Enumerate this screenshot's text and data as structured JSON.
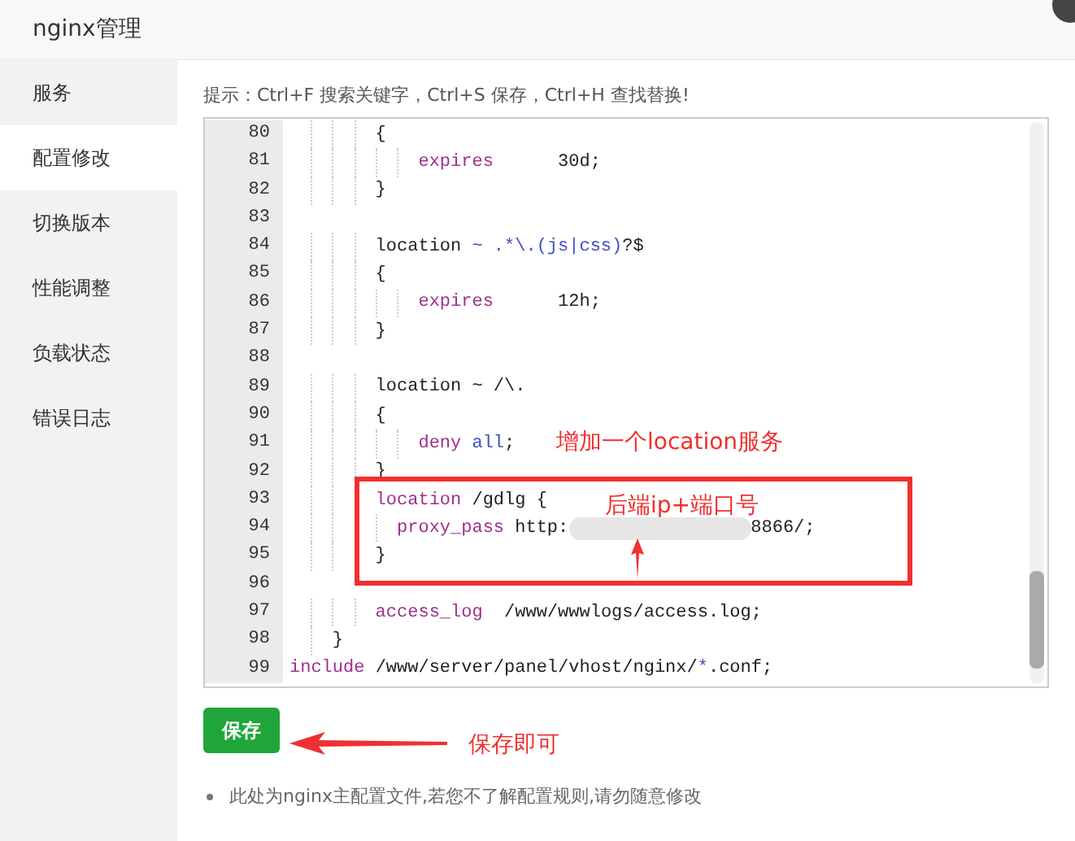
{
  "window": {
    "title": "nginx管理"
  },
  "sidebar": {
    "items": [
      {
        "label": "服务",
        "selected": false
      },
      {
        "label": "配置修改",
        "selected": true
      },
      {
        "label": "切换版本",
        "selected": false
      },
      {
        "label": "性能调整",
        "selected": false
      },
      {
        "label": "负载状态",
        "selected": false
      },
      {
        "label": "错误日志",
        "selected": false
      }
    ]
  },
  "hint": "提示：Ctrl+F 搜索关键字，Ctrl+S 保存，Ctrl+H 查找替换!",
  "editor": {
    "lines": [
      {
        "number": "80",
        "tokens": [
          {
            "text": "        {",
            "kind": "plain"
          }
        ]
      },
      {
        "number": "81",
        "tokens": [
          {
            "text": "            expires",
            "kind": "keyword"
          },
          {
            "text": "      30d;",
            "kind": "plain"
          }
        ]
      },
      {
        "number": "82",
        "tokens": [
          {
            "text": "        }",
            "kind": "plain"
          }
        ]
      },
      {
        "number": "83"
      },
      {
        "number": "84",
        "tokens": [
          {
            "text": "        location ",
            "kind": "plain"
          },
          {
            "text": "~ .*\\.(js|css)",
            "kind": "operator"
          },
          {
            "text": "?$",
            "kind": "plain"
          }
        ]
      },
      {
        "number": "85",
        "tokens": [
          {
            "text": "        {",
            "kind": "plain"
          }
        ]
      },
      {
        "number": "86",
        "tokens": [
          {
            "text": "            expires",
            "kind": "keyword"
          },
          {
            "text": "      12h;",
            "kind": "plain"
          }
        ]
      },
      {
        "number": "87",
        "tokens": [
          {
            "text": "        }",
            "kind": "plain"
          }
        ]
      },
      {
        "number": "88"
      },
      {
        "number": "89",
        "tokens": [
          {
            "text": "        location ~ /\\.",
            "kind": "plain"
          }
        ]
      },
      {
        "number": "90",
        "tokens": [
          {
            "text": "        {",
            "kind": "plain"
          }
        ]
      },
      {
        "number": "91",
        "tokens": [
          {
            "text": "            deny",
            "kind": "keyword"
          },
          {
            "text": " all",
            "kind": "operator"
          },
          {
            "text": ";",
            "kind": "plain"
          }
        ]
      },
      {
        "number": "92",
        "tokens": [
          {
            "text": "        }",
            "kind": "plain"
          }
        ]
      },
      {
        "number": "93",
        "tokens": [
          {
            "text": "        location",
            "kind": "keyword"
          },
          {
            "text": " /gdlg {",
            "kind": "plain"
          }
        ]
      },
      {
        "number": "94",
        "tokens": [
          {
            "text": "          proxy_pass",
            "kind": "keyword"
          },
          {
            "text": " http:",
            "kind": "plain"
          },
          {
            "kind": "blur"
          },
          {
            "text": "8866/;",
            "kind": "plain"
          }
        ]
      },
      {
        "number": "95",
        "tokens": [
          {
            "text": "        }",
            "kind": "plain"
          }
        ]
      },
      {
        "number": "96"
      },
      {
        "number": "97",
        "tokens": [
          {
            "text": "        access_log",
            "kind": "keyword"
          },
          {
            "text": "  /www/wwwlogs/access.log;",
            "kind": "plain"
          }
        ]
      },
      {
        "number": "98",
        "tokens": [
          {
            "text": "    }",
            "kind": "plain"
          }
        ]
      },
      {
        "number": "99",
        "tokens": [
          {
            "text": "include",
            "kind": "keyword"
          },
          {
            "text": " /www/server/panel/vhost/nginx/",
            "kind": "plain"
          },
          {
            "text": "*",
            "kind": "operator"
          },
          {
            "text": ".conf;",
            "kind": "plain"
          }
        ]
      }
    ]
  },
  "annotations": {
    "add_note": "增加一个location服务",
    "backend_note": "后端ip+端口号",
    "save_note": "保存即可"
  },
  "save_button": "保存",
  "notes": [
    "此处为nginx主配置文件,若您不了解配置规则,请勿随意修改"
  ]
}
